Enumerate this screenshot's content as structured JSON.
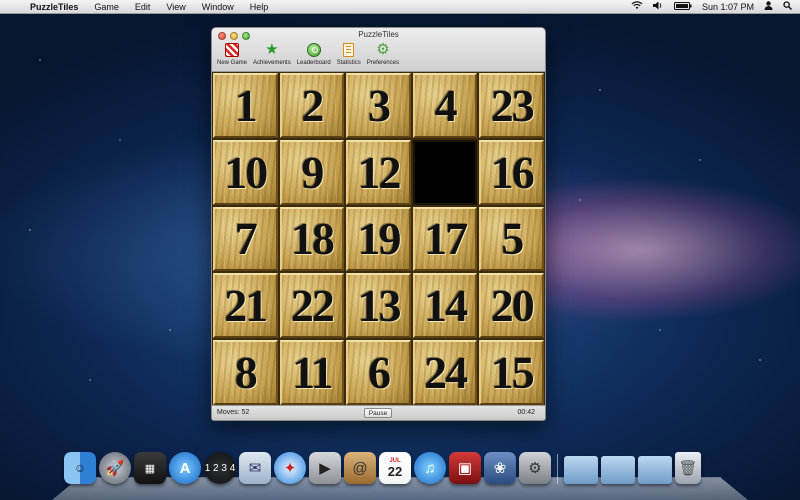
{
  "menubar": {
    "app_name": "PuzzleTiles",
    "items": [
      "Game",
      "Edit",
      "View",
      "Window",
      "Help"
    ],
    "clock": "Sun 1:07 PM"
  },
  "window": {
    "title": "PuzzleTiles",
    "toolbar": [
      {
        "label": "New Game",
        "icon": "new-game-icon"
      },
      {
        "label": "Achievements",
        "icon": "star-icon"
      },
      {
        "label": "Leaderboard",
        "icon": "leaderboard-icon"
      },
      {
        "label": "Statistics",
        "icon": "statistics-icon"
      },
      {
        "label": "Preferences",
        "icon": "gear-icon"
      }
    ],
    "board": [
      [
        "1",
        "2",
        "3",
        "4",
        "23"
      ],
      [
        "10",
        "9",
        "12",
        "",
        "16"
      ],
      [
        "7",
        "18",
        "19",
        "17",
        "5"
      ],
      [
        "21",
        "22",
        "13",
        "14",
        "20"
      ],
      [
        "8",
        "11",
        "6",
        "24",
        "15"
      ]
    ],
    "status": {
      "moves_label": "Moves:",
      "moves_value": "52",
      "pause_label": "Pause",
      "timer": "00:42"
    }
  },
  "dock": {
    "ical_date": "22",
    "ical_month": "JUL",
    "dashboard_text": "1 2 3 4"
  }
}
